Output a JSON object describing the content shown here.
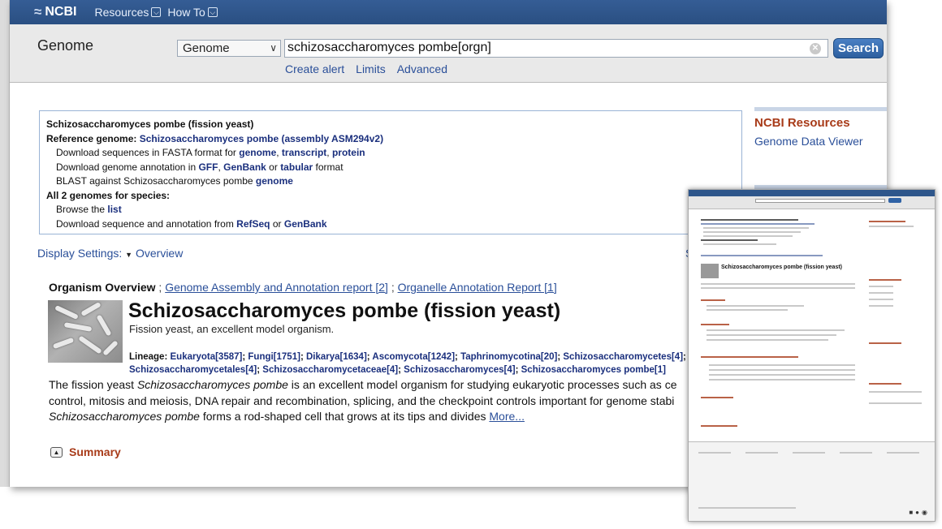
{
  "topbar": {
    "logo": "NCBI",
    "resources": "Resources",
    "howto": "How To"
  },
  "search": {
    "db_title": "Genome",
    "db_select": "Genome",
    "query": "schizosaccharomyces pombe[orgn]",
    "button": "Search",
    "links": [
      "Create alert",
      "Limits",
      "Advanced"
    ]
  },
  "reference": {
    "title": "Schizosaccharomyces pombe (fission yeast)",
    "ref_label": "Reference genome:",
    "ref_link": "Schizosaccharomyces pombe (assembly ASM294v2)",
    "dl_prefix": "Download sequences in FASTA format for",
    "dl_genome": "genome",
    "dl_transcript": "transcript",
    "dl_protein": "protein",
    "ann_prefix": "Download genome annotation in",
    "ann_gff": "GFF",
    "ann_genbank": "GenBank",
    "ann_or": "or",
    "ann_tabular": "tabular",
    "ann_suffix": "format",
    "blast_prefix": "BLAST against Schizosaccharomyces pombe",
    "blast_link": "genome",
    "all_label": "All 2 genomes for species:",
    "browse_prefix": "Browse the",
    "browse_link": "list",
    "seq_prefix": "Download sequence and annotation from",
    "seq_refseq": "RefSeq",
    "seq_or": "or",
    "seq_genbank": "GenBank"
  },
  "right_column": {
    "title": "NCBI Resources",
    "item": "Genome Data Viewer"
  },
  "display": {
    "settings": "Display Settings:",
    "overview": "Overview",
    "right_char": "S"
  },
  "organism": {
    "overview_label": "Organism Overview",
    "assembly_link": "Genome Assembly and Annotation report [2]",
    "organelle_link": "Organelle Annotation Report [1]",
    "title": "Schizosaccharomyces pombe (fission yeast)",
    "subtitle": "Fission yeast, an excellent model organism.",
    "lineage_label": "Lineage:",
    "lineage_items": [
      "Eukaryota[3587]",
      "Fungi[1751]",
      "Dikarya[1634]",
      "Ascomycota[1242]",
      "Taphrinomycotina[20]",
      "Schizosaccharomycetes[4]",
      "Schizosaccharomycetales[4]",
      "Schizosaccharomycetaceae[4]",
      "Schizosaccharomyces[4]",
      "Schizosaccharomyces pombe[1]"
    ],
    "desc_line1_pre": "The fission yeast ",
    "desc_italic1": "Schizosaccharomyces pombe",
    "desc_line1_post": " is an excellent model organism for studying eukaryotic processes such as ce",
    "desc_line2": "control, mitosis and meiosis, DNA repair and recombination, splicing, and the checkpoint controls important for genome stabi",
    "desc_italic2": "Schizosaccharomyces pombe",
    "desc_line3_post": " forms a rod-shaped cell that grows at its tips and divides ",
    "more": "More..."
  },
  "summary": {
    "label": "Summary"
  },
  "thumbnail": {
    "title": "Schizosaccharomyces pombe (fission yeast)"
  }
}
